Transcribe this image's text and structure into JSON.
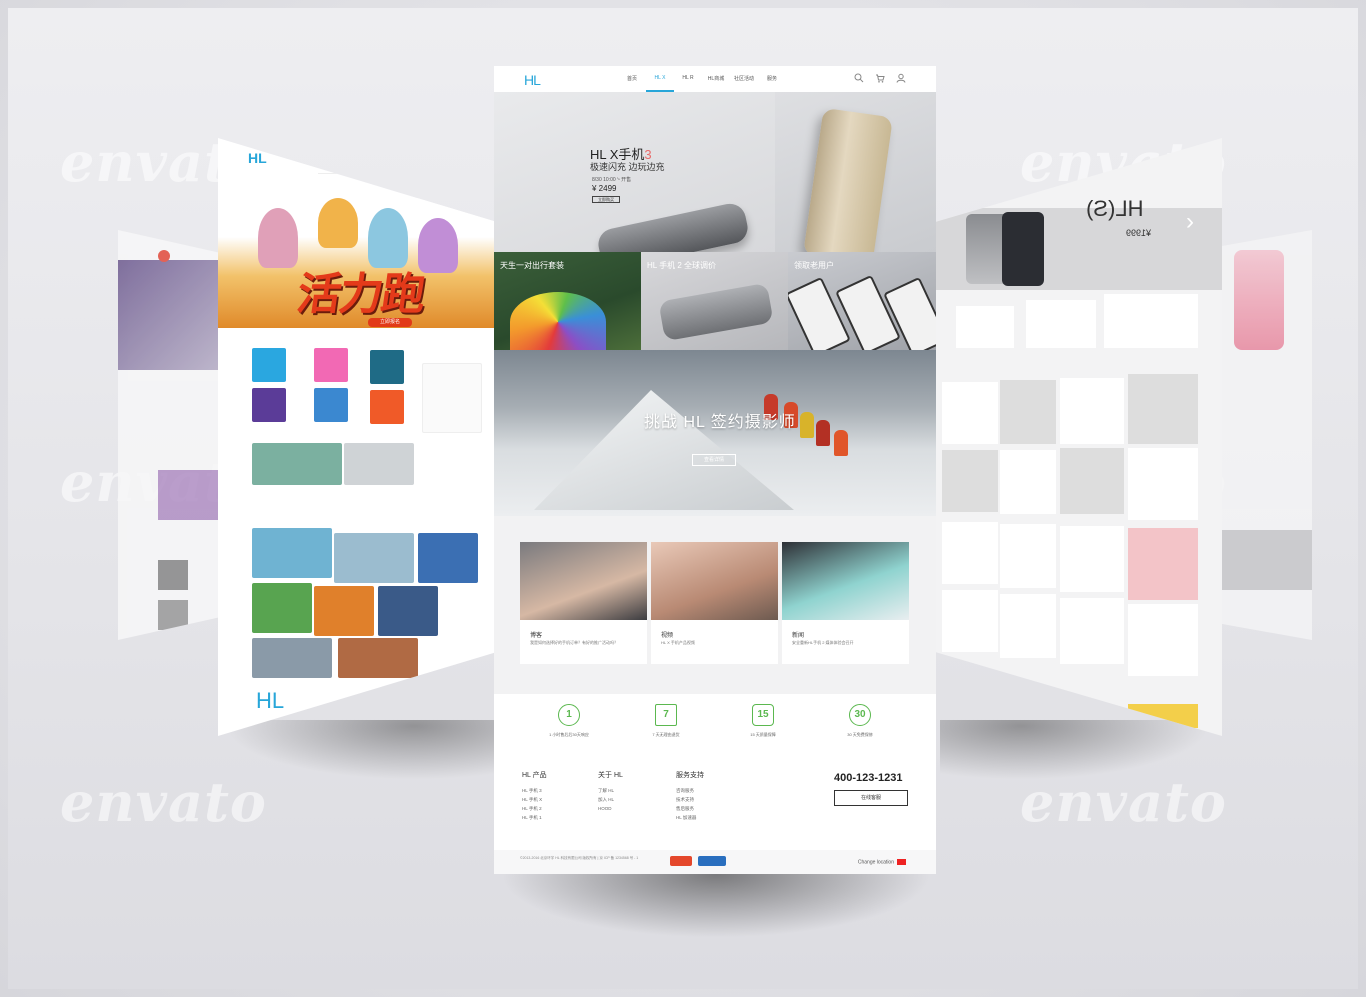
{
  "watermark": "envato",
  "center": {
    "logo": "HL",
    "nav": [
      "首页",
      "HL X",
      "HL R",
      "HL商城",
      "社区活动",
      "服务"
    ],
    "nav_active_index": 1,
    "hero": {
      "title": "HL X手机",
      "title_suffix": "3",
      "subtitle": "极速闪充  边玩边充",
      "date": "8/30 10:00 ⁱⁿ 开售",
      "price": "¥ 2499",
      "button": "立即购买"
    },
    "promos": [
      "天生一对出行套装",
      "HL 手机 2 全球调价",
      "领取老用户"
    ],
    "banner": {
      "title": "挑战 HL 签约摄影师",
      "button": "查看详情"
    },
    "cards": [
      {
        "title": "博客",
        "desc": "我是如何选择好的手机订单？有好的推广活动吗？"
      },
      {
        "title": "视频",
        "desc": "HL X 手机产品视频"
      },
      {
        "title": "新闻",
        "desc": "安全重新HL手机 2 媒体体验会召开"
      }
    ],
    "services": [
      {
        "icon": "1",
        "label": "1 小时售后后30天响应"
      },
      {
        "icon": "7",
        "label": "7 天无理由退货"
      },
      {
        "icon": "15",
        "label": "15 天质量保障"
      },
      {
        "icon": "30",
        "label": "30 天免费保修"
      }
    ],
    "footer": {
      "cols": [
        {
          "title": "HL 产品",
          "items": [
            "HL 手机 3",
            "HL 手机 X",
            "HL 手机 2",
            "HL 手机 1"
          ]
        },
        {
          "title": "关于 HL",
          "items": [
            "了解 HL",
            "加入 HL",
            "HOOD"
          ]
        },
        {
          "title": "服务支持",
          "items": [
            "咨询服务",
            "技术支持",
            "售后服务",
            "HL 加速器"
          ]
        }
      ],
      "phone": "400-123-1231",
      "service_button": "在线客服",
      "copyright": "©2013-2016 北京环宇 HL 科技有限公司 版权所有 | 京 ICP 备 1234568 号 - 1",
      "locale": "Change location"
    }
  },
  "left_page": {
    "logo": "HL",
    "banner_text": "活力跑",
    "button": "立即报名",
    "footer_logo": "HL"
  },
  "right_page": {
    "title": "HL(S)",
    "price": "¥1999"
  },
  "colors": {
    "brand": "#27a6d9",
    "accent_red": "#e43a1a",
    "service_green": "#5bb84f"
  }
}
